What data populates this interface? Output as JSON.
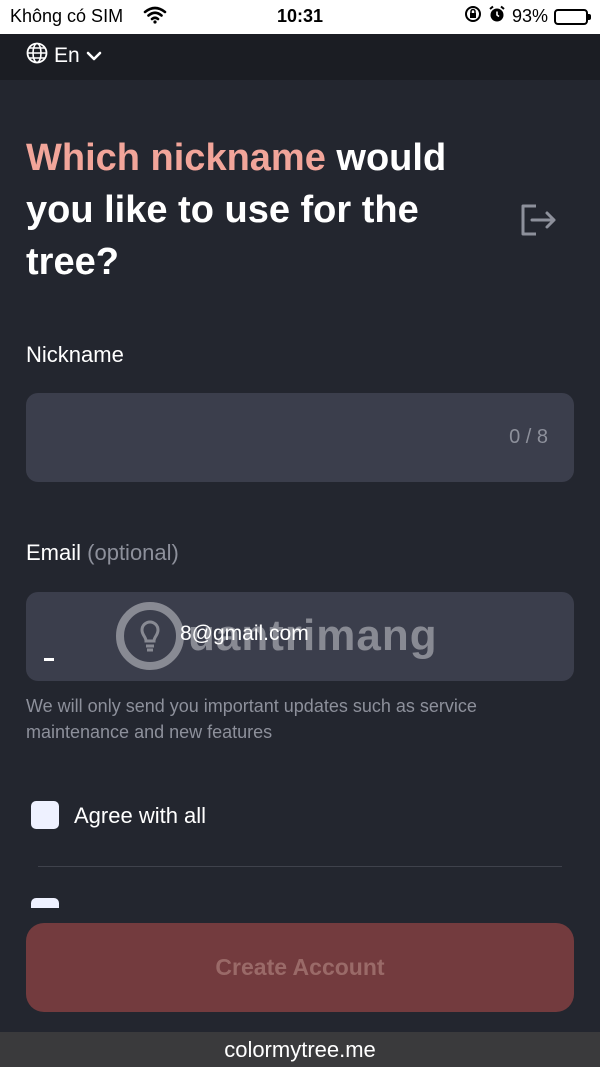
{
  "status_bar": {
    "carrier": "Không có SIM",
    "time": "10:31",
    "battery": "93%"
  },
  "topbar": {
    "language": "En"
  },
  "headline": {
    "accent": "Which nickname",
    "rest": " would you like to use for the tree?"
  },
  "nickname": {
    "label": "Nickname",
    "value": "",
    "counter": "0 / 8"
  },
  "email": {
    "label": "Email",
    "optional": "(optional)",
    "value": "8@gmail.com",
    "hint": "We will only send you important updates such as service maintenance and new features"
  },
  "agreement": {
    "agree_all_label": "Agree with all",
    "checked": false
  },
  "create_button": {
    "label": "Create Account",
    "enabled": false
  },
  "watermark": {
    "text": "uantrimang"
  },
  "url_bar": {
    "url": "colormytree.me"
  },
  "colors": {
    "background": "#23262f",
    "accent": "#f2a59a",
    "field": "#3b3e4c",
    "button_disabled": "#733b3e"
  }
}
